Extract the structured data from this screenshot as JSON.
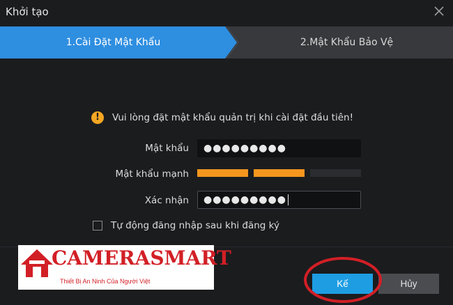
{
  "window": {
    "title": "Khởi tạo",
    "close_icon": "close-icon"
  },
  "steps": [
    {
      "label": "1.Cài Đặt Mật Khẩu",
      "active": true
    },
    {
      "label": "2.Mật Khẩu Bảo Vệ",
      "active": false
    }
  ],
  "colors": {
    "accent": "#1e9de3",
    "step_active": "#2e8ee0",
    "warning": "#f5a623",
    "strength": "#f5961e",
    "annotation_red": "#d21f26"
  },
  "form": {
    "warning_icon": "warning-icon",
    "warning_text": "Vui lòng đặt mật khẩu quản trị khi cài đặt đầu tiên!",
    "password_label": "Mật khẩu",
    "password_value": "●●●●●●●●●",
    "strength_label": "Mật khẩu mạnh",
    "strength_level": 2,
    "strength_max": 3,
    "confirm_label": "Xác nhận",
    "confirm_value": "●●●●●●●●●",
    "autologin_label": "Tự động đăng nhập sau khi đăng ký",
    "autologin_checked": false
  },
  "buttons": {
    "next": "Kế",
    "cancel": "Hủy"
  },
  "watermark": {
    "brand": "CAMERASMART",
    "tagline": "Thiết Bị An Ninh Của Người Việt",
    "icon": "house-icon"
  }
}
